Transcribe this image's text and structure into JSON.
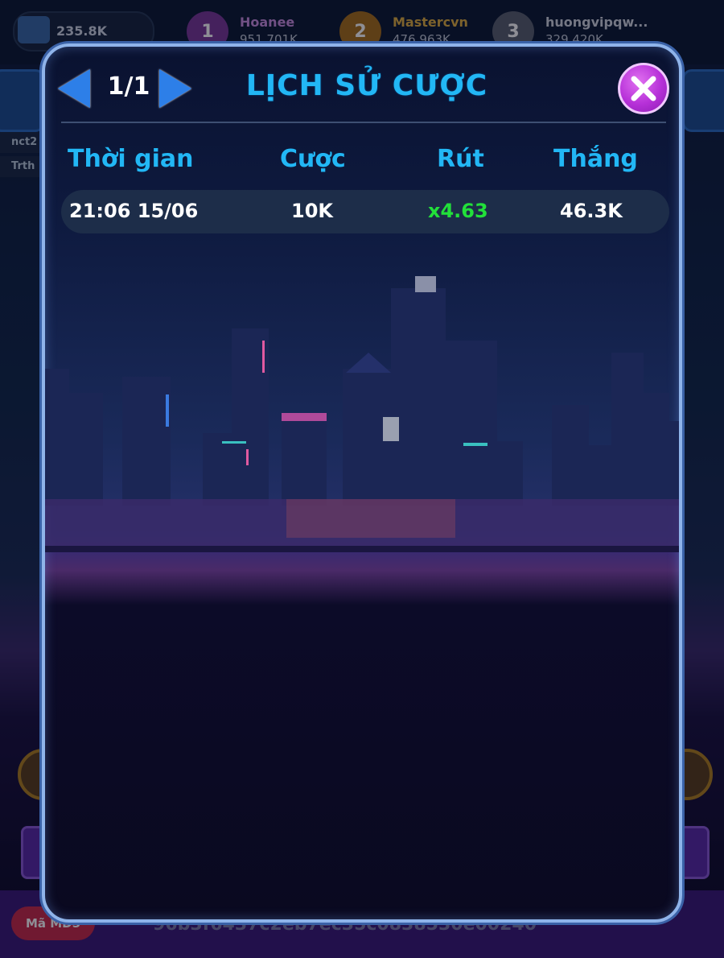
{
  "wallet": {
    "amount": "235.8K"
  },
  "leaderboard": [
    {
      "rank": "1",
      "name": "Hoanee",
      "score": "951.701K",
      "color": "#c98ee0"
    },
    {
      "rank": "2",
      "name": "Mastercvn",
      "score": "476.963K",
      "color": "#e0b040"
    },
    {
      "rank": "3",
      "name": "huongvipqw...",
      "score": "329.420K",
      "color": "#d0d6e0"
    }
  ],
  "side_chips": [
    "nct2",
    "Trth"
  ],
  "bottom": {
    "md5_label": "Mã MD5",
    "md5_hash": "96b3f6437c2eb7ec35c0838530e00240"
  },
  "modal": {
    "title": "LỊCH SỬ CƯỢC",
    "page_indicator": "1/1",
    "columns": {
      "time": "Thời gian",
      "bet": "Cược",
      "cashout": "Rút",
      "win": "Thắng"
    },
    "rows": [
      {
        "time": "21:06 15/06",
        "bet": "10K",
        "cashout": "x4.63",
        "win": "46.3K"
      }
    ]
  },
  "colors": {
    "title": "#22b7f5",
    "cashout": "#22e03a",
    "close_button": "#b630d8"
  }
}
